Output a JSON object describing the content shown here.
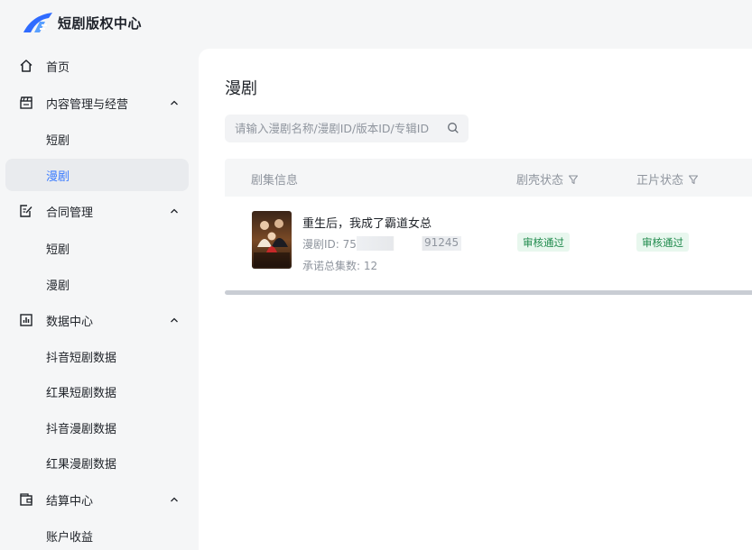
{
  "app": {
    "title": "短剧版权中心"
  },
  "colors": {
    "accent": "#3a7bff",
    "badge_bg": "#e8f7ee",
    "badge_text": "#1f8a4c",
    "active_bg": "#e9ebee"
  },
  "sidebar": {
    "home": {
      "label": "首页",
      "icon": "home-icon"
    },
    "content": {
      "label": "内容管理与经营",
      "icon": "clapperboard-icon",
      "items": [
        {
          "label": "短剧"
        },
        {
          "label": "漫剧",
          "active": true
        }
      ]
    },
    "contract": {
      "label": "合同管理",
      "icon": "edit-document-icon",
      "items": [
        {
          "label": "短剧"
        },
        {
          "label": "漫剧"
        }
      ]
    },
    "data_center": {
      "label": "数据中心",
      "icon": "bar-chart-icon",
      "items": [
        {
          "label": "抖音短剧数据"
        },
        {
          "label": "红果短剧数据"
        },
        {
          "label": "抖音漫剧数据"
        },
        {
          "label": "红果漫剧数据"
        }
      ]
    },
    "settlement": {
      "label": "结算中心",
      "icon": "wallet-icon",
      "items": [
        {
          "label": "账户收益"
        }
      ]
    }
  },
  "main": {
    "title": "漫剧",
    "search": {
      "placeholder": "请输入漫剧名称/漫剧ID/版本ID/专辑ID",
      "value": ""
    },
    "table": {
      "columns": {
        "info": "剧集信息",
        "trailer_status": "剧壳状态",
        "feature_status": "正片状态"
      },
      "rows": [
        {
          "title": "重生后，我成了霸道女总",
          "id_prefix": "漫剧ID: 7592",
          "id_suffix": "91245",
          "episodes": "承诺总集数: 12",
          "trailer_status": "审核通过",
          "feature_status": "审核通过",
          "poster_text": "重生后 我成了霸道女总"
        }
      ]
    }
  }
}
